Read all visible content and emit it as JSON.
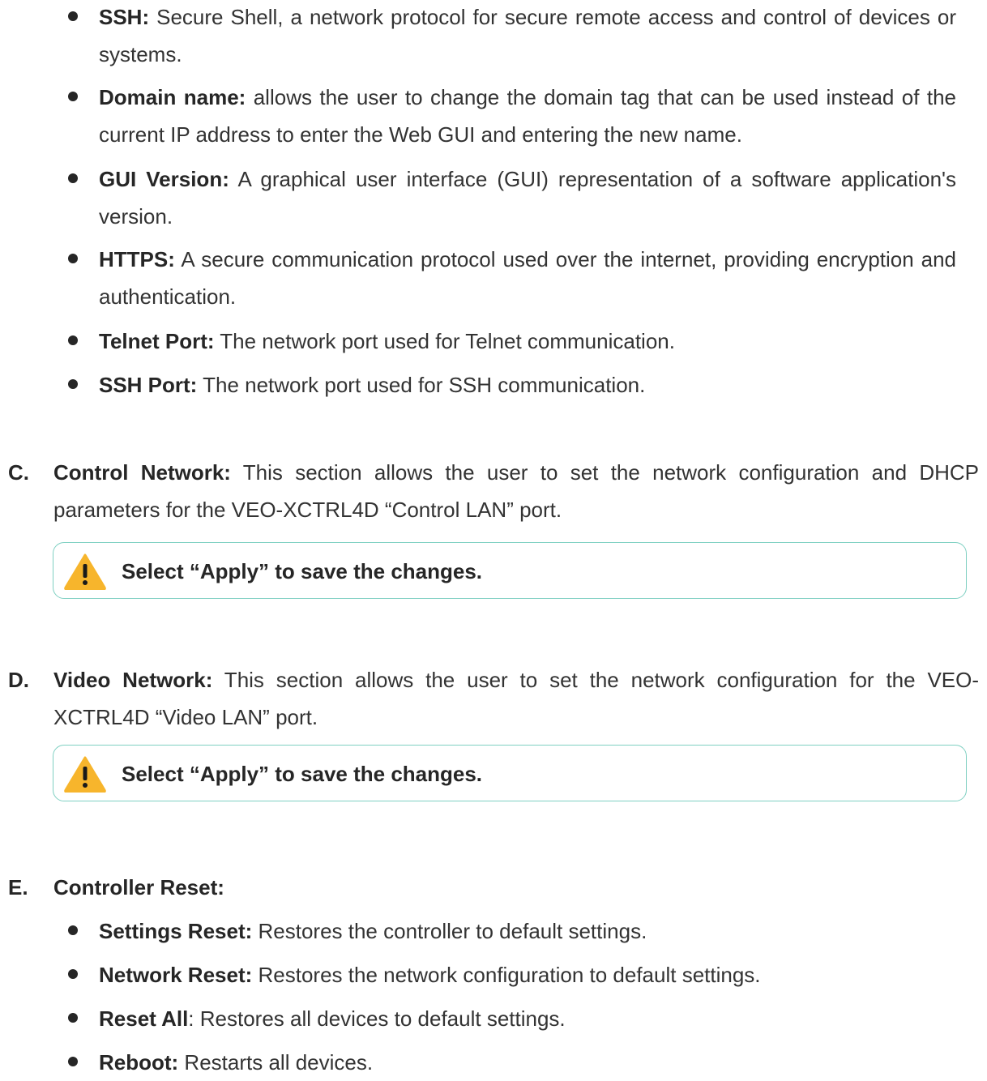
{
  "bullets_top": [
    {
      "term": "SSH:",
      "desc": " Secure Shell, a network protocol for secure remote access and control of devices or systems."
    },
    {
      "term": "Domain name:",
      "desc": " allows the user to change the domain tag that can be used instead of the current IP address to enter the Web GUI and entering the new name."
    },
    {
      "term": "GUI Version:",
      "desc": " A graphical user interface (GUI) representation of a software application's version."
    },
    {
      "term": "HTTPS:",
      "desc": " A secure communication protocol used over the internet, providing encryption and authentication."
    },
    {
      "term": "Telnet Port:",
      "desc": " The network port used for Telnet communication."
    },
    {
      "term": "SSH Port:",
      "desc": " The network port used for SSH communication."
    }
  ],
  "section_c": {
    "letter": "C.",
    "term": "Control Network:",
    "desc": " This section allows the user to set the network configuration and DHCP parameters for the VEO-XCTRL4D “Control LAN” port.",
    "note": "Select “Apply” to save the changes."
  },
  "section_d": {
    "letter": "D.",
    "term": "Video Network:",
    "desc": " This section allows the user to set the network configuration for the VEO-XCTRL4D “Video LAN” port.",
    "note": "Select “Apply” to save the changes."
  },
  "section_e": {
    "letter": "E.",
    "term": "Controller Reset:"
  },
  "bullets_bottom": [
    {
      "term": "Settings Reset:",
      "desc": " Restores the controller to default settings."
    },
    {
      "term": "Network Reset:",
      "desc": " Restores the network configuration to default settings."
    },
    {
      "term": "Reset All",
      "desc": ": Restores all devices to default settings."
    },
    {
      "term": "Reboot:",
      "desc": " Restarts all devices."
    }
  ],
  "colors": {
    "note_border": "#7fd0c2",
    "warning_fill": "#f7b52c"
  },
  "icons": {
    "note_icon": "warning-triangle-icon"
  }
}
